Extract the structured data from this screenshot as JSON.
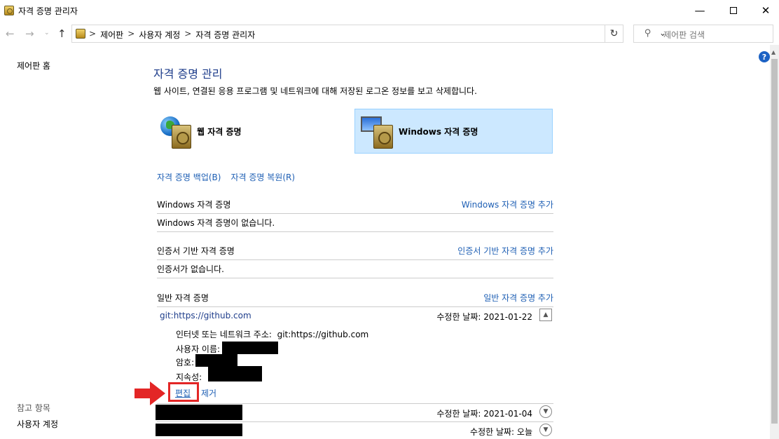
{
  "window": {
    "title": "자격 증명 관리자",
    "minimize": "—",
    "close": "✕"
  },
  "navbar": {
    "back": "←",
    "forward": "→",
    "history": "⌄",
    "up": "↑",
    "breadcrumbs": [
      "제어판",
      "사용자 계정",
      "자격 증명 관리자"
    ],
    "separator": ">",
    "dropdown": "⌄",
    "refresh": "↻",
    "search_placeholder": "제어판 검색",
    "search_icon": "⚲"
  },
  "sidebar": {
    "home": "제어판 홈",
    "see_also": "참고 항목",
    "user_accounts": "사용자 계정"
  },
  "help_icon": "?",
  "main": {
    "title": "자격 증명 관리",
    "description": "웹 사이트, 연결된 응용 프로그램 및 네트워크에 대해 저장된 로그온 정보를 보고 삭제합니다.",
    "categories": {
      "web": "웹 자격 증명",
      "windows": "Windows 자격 증명"
    },
    "links": {
      "backup": "자격 증명 백업(B)",
      "restore": "자격 증명 복원(R)"
    },
    "sections": {
      "windows": {
        "header": "Windows 자격 증명",
        "add": "Windows 자격 증명 추가",
        "empty": "Windows 자격 증명이 없습니다."
      },
      "certificate": {
        "header": "인증서 기반 자격 증명",
        "add": "인증서 기반 자격 증명 추가",
        "empty": "인증서가 없습니다."
      },
      "generic": {
        "header": "일반 자격 증명",
        "add": "일반 자격 증명 추가"
      }
    },
    "credentials": [
      {
        "name": "git:https://github.com",
        "modified": "수정한 날짜:  2021-01-22"
      },
      {
        "name": "",
        "modified": "수정한 날짜:  2021-01-04"
      },
      {
        "name": "",
        "modified": "수정한 날짜:  오늘"
      }
    ],
    "details": {
      "address_label": "인터넷 또는 네트워크 주소:",
      "address_value": "git:https://github.com",
      "username_label": "사용자 이름:",
      "password_label": "암호:",
      "persistence_label": "지속성:"
    },
    "actions": {
      "edit": "편집",
      "remove": "제거"
    }
  },
  "colors": {
    "accent_link": "#1e5fb4",
    "title": "#1e3d8b",
    "selected_bg": "#cce8ff",
    "annotation_red": "#e32626"
  }
}
